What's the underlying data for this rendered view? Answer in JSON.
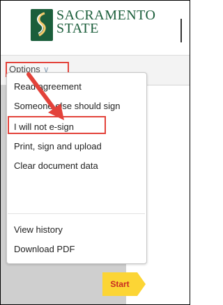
{
  "header": {
    "logo_line1": "SACRAMENTO",
    "logo_line2": "STATE",
    "logo_icon": "sacramento-state-seal"
  },
  "toolbar": {
    "options_label": "Options",
    "options_icon": "chevron-down-icon"
  },
  "menu": {
    "items": [
      {
        "label": "Read agreement"
      },
      {
        "label": "Someone else should sign"
      },
      {
        "label": "I will not e-sign"
      },
      {
        "label": "Print, sign and upload"
      },
      {
        "label": "Clear document data"
      },
      {
        "label": "View history"
      },
      {
        "label": "Download PDF"
      }
    ]
  },
  "start_button": {
    "label": "Start"
  },
  "colors": {
    "brand_green": "#1b5e3b",
    "highlight_red": "#e3423a",
    "start_yellow": "#fcd535"
  }
}
